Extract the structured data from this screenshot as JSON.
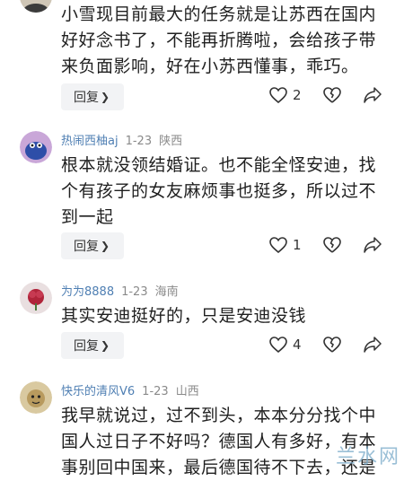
{
  "comments": [
    {
      "lines": [
        "小雪现目前最大的任务就是让苏西在国内",
        "好好念书了，不能再折腾啦，会给孩子带",
        "来负面影响，好在小苏西懂事，乖巧。"
      ],
      "reply_label": "回复",
      "likes": "2"
    },
    {
      "name": "热闹西柚aj",
      "date": "1-23",
      "location": "陕西",
      "lines": [
        "根本就没领结婚证。也不能全怪安迪，找",
        "个有孩子的女友麻烦事也挺多，所以过不",
        "到一起"
      ],
      "reply_label": "回复",
      "likes": "1"
    },
    {
      "name": "为为8888",
      "date": "1-23",
      "location": "海南",
      "lines": [
        "其实安迪挺好的，只是安迪没钱"
      ],
      "reply_label": "回复",
      "likes": "4"
    },
    {
      "name": "快乐的清风V6",
      "date": "1-23",
      "location": "山西",
      "lines": [
        "我早就说过，过不到头，本本分分找个中",
        "国人过日子不好吗？德国人有多好，有本",
        "事别回中国来，最后德国待不下去，还是"
      ]
    }
  ],
  "watermark": "兰水网"
}
